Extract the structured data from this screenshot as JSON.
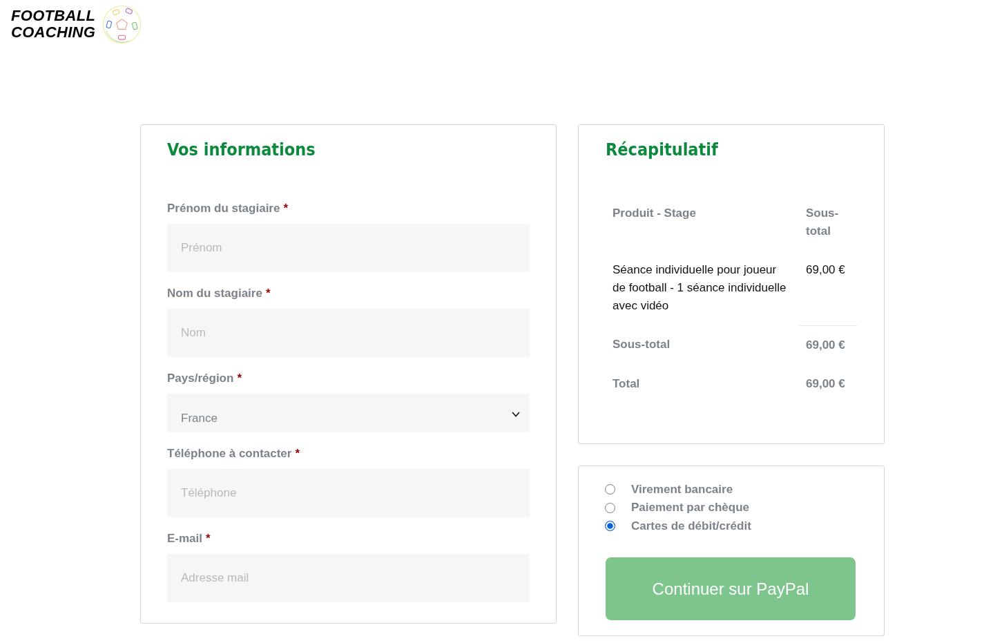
{
  "logo": {
    "lines": [
      "FOOTBALL",
      "COACHING"
    ]
  },
  "customer_form": {
    "title": "Vos informations",
    "required_marker": "*",
    "fields": [
      {
        "kind": "text",
        "label": "Prénom du stagiaire",
        "required": true,
        "placeholder": "Prénom"
      },
      {
        "kind": "text",
        "label": "Nom du stagiaire",
        "required": true,
        "placeholder": "Nom"
      },
      {
        "kind": "select",
        "label": "Pays/région",
        "required": true,
        "value": "France"
      },
      {
        "kind": "text",
        "label": "Téléphone à contacter",
        "required": true,
        "placeholder": "Téléphone"
      },
      {
        "kind": "text",
        "label": "E-mail",
        "required": true,
        "placeholder": "Adresse mail"
      }
    ]
  },
  "summary": {
    "title": "Récapitulatif",
    "columns": [
      "Produit - Stage",
      "Sous-total"
    ],
    "rows": [
      {
        "product": "Séance individuelle pour joueur de football - 1 séance individuelle avec vidéo",
        "subtotal": "69,00 €"
      }
    ],
    "totals": [
      {
        "label": "Sous-total",
        "value": "69,00 €"
      },
      {
        "label": "Total",
        "value": "69,00 €"
      }
    ]
  },
  "payment": {
    "methods": [
      {
        "label": "Virement bancaire",
        "selected": false
      },
      {
        "label": "Paiement par chèque",
        "selected": false
      },
      {
        "label": "Cartes de débit/crédit",
        "selected": true
      }
    ],
    "button": "Continuer sur PayPal"
  }
}
